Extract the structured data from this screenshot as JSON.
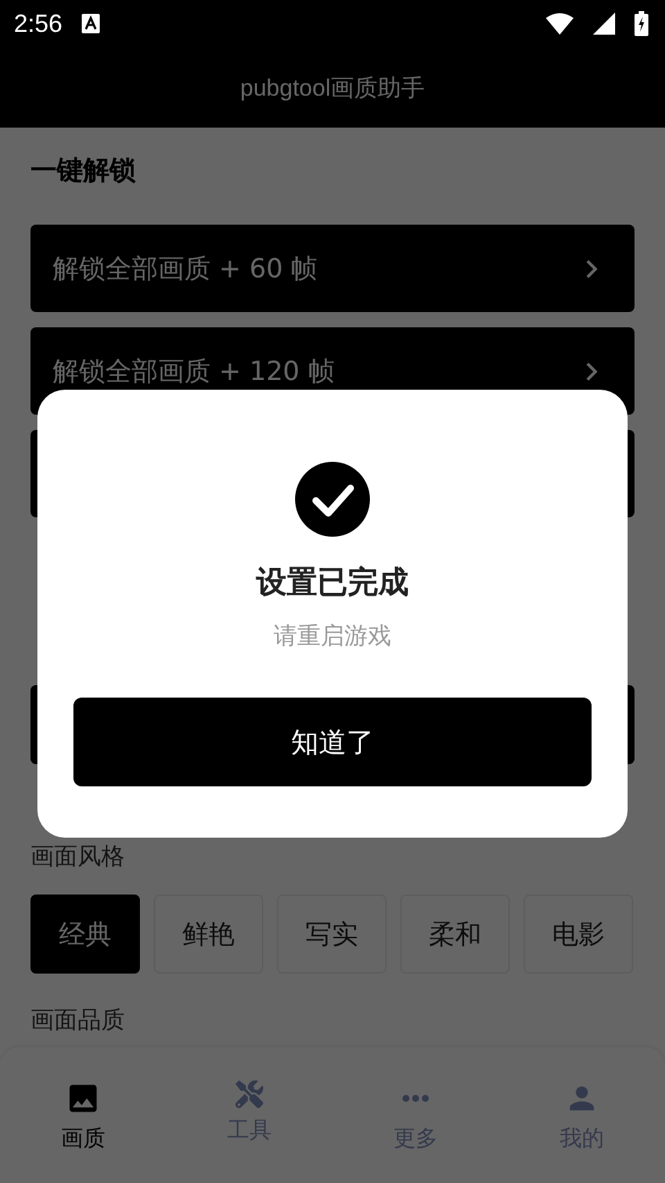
{
  "status_bar": {
    "time": "2:56"
  },
  "app_bar": {
    "title": "pubgtool画质助手"
  },
  "unlock_section": {
    "heading": "一键解锁",
    "options": [
      {
        "label": "解锁全部画质 + 60 帧"
      },
      {
        "label": "解锁全部画质 + 120 帧"
      }
    ]
  },
  "style_section": {
    "heading": "画面风格",
    "chips": [
      {
        "label": "经典",
        "selected": true
      },
      {
        "label": "鲜艳",
        "selected": false
      },
      {
        "label": "写实",
        "selected": false
      },
      {
        "label": "柔和",
        "selected": false
      },
      {
        "label": "电影",
        "selected": false
      }
    ]
  },
  "quality_section": {
    "heading": "画面品质"
  },
  "bottom_nav": {
    "items": [
      {
        "label": "画质",
        "selected": true
      },
      {
        "label": "工具",
        "selected": false
      },
      {
        "label": "更多",
        "selected": false
      },
      {
        "label": "我的",
        "selected": false
      }
    ]
  },
  "dialog": {
    "title": "设置已完成",
    "message": "请重启游戏",
    "button": "知道了"
  }
}
